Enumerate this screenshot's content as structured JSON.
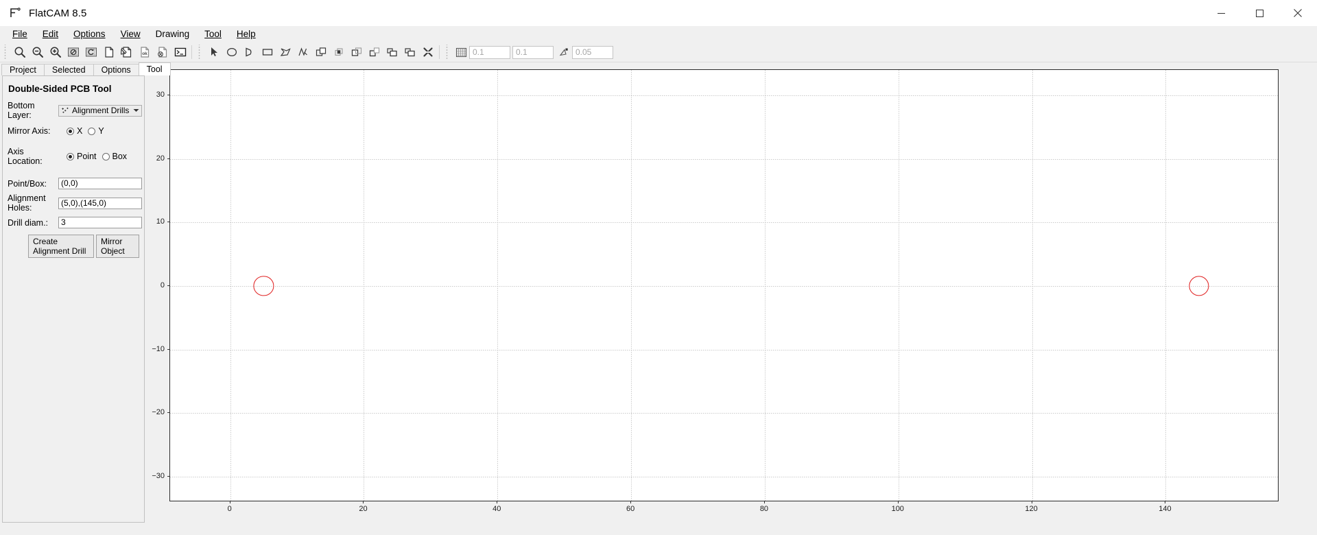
{
  "window": {
    "title": "FlatCAM 8.5",
    "app_icon": "flatcam-logo-icon",
    "minimize_label": "Minimize",
    "maximize_label": "Maximize",
    "close_label": "Close"
  },
  "menubar": {
    "items": [
      {
        "label": "File",
        "mnemonic": "F"
      },
      {
        "label": "Edit",
        "mnemonic": "E"
      },
      {
        "label": "Options",
        "mnemonic": "O"
      },
      {
        "label": "View",
        "mnemonic": "V"
      },
      {
        "label": "Drawing",
        "mnemonic": ""
      },
      {
        "label": "Tool",
        "mnemonic": "T"
      },
      {
        "label": "Help",
        "mnemonic": "H"
      }
    ]
  },
  "toolbar": {
    "group1": [
      {
        "name": "zoom-fit-icon",
        "tooltip": "Zoom Fit"
      },
      {
        "name": "zoom-out-icon",
        "tooltip": "Zoom Out"
      },
      {
        "name": "zoom-in-icon",
        "tooltip": "Zoom In"
      },
      {
        "name": "clear-plot-icon",
        "tooltip": "Clear Plot"
      },
      {
        "name": "replot-icon",
        "tooltip": "Replot"
      },
      {
        "name": "new-blank-geometry-icon",
        "tooltip": "New Blank Geometry"
      },
      {
        "name": "edit-geometry-icon",
        "tooltip": "Edit Geometry"
      },
      {
        "name": "update-geometry-ok-icon",
        "tooltip": "Update Geometry"
      },
      {
        "name": "delete-object-icon",
        "tooltip": "Delete Object"
      },
      {
        "name": "shell-terminal-icon",
        "tooltip": "Command Line"
      }
    ],
    "group2": [
      {
        "name": "select-arrow-icon",
        "tooltip": "Select"
      },
      {
        "name": "draw-circle-icon",
        "tooltip": "Add Circle"
      },
      {
        "name": "draw-arc-icon",
        "tooltip": "Add Arc"
      },
      {
        "name": "draw-rectangle-icon",
        "tooltip": "Add Rectangle"
      },
      {
        "name": "draw-polygon-icon",
        "tooltip": "Add Polygon"
      },
      {
        "name": "draw-path-icon",
        "tooltip": "Add Path"
      },
      {
        "name": "union-icon",
        "tooltip": "Union"
      },
      {
        "name": "intersection-icon",
        "tooltip": "Intersection"
      },
      {
        "name": "subtract-icon",
        "tooltip": "Subtraction"
      },
      {
        "name": "cut-path-icon",
        "tooltip": "Cut Path"
      },
      {
        "name": "copy-shape-icon",
        "tooltip": "Copy Shape"
      },
      {
        "name": "move-shape-icon",
        "tooltip": "Move Shape"
      },
      {
        "name": "delete-shape-icon",
        "tooltip": "Delete Shape"
      }
    ],
    "grid": {
      "grid_icon": "snap-to-grid-icon",
      "grid_x_value": "0.1",
      "grid_y_value": "0.1",
      "corner_snap_icon": "snap-to-corner-icon",
      "snap_max_value": "0.05"
    }
  },
  "tabs": {
    "items": [
      {
        "label": "Project",
        "active": false
      },
      {
        "label": "Selected",
        "active": false
      },
      {
        "label": "Options",
        "active": false
      },
      {
        "label": "Tool",
        "active": true
      }
    ]
  },
  "tool_panel": {
    "title": "Double-Sided PCB Tool",
    "bottom_layer": {
      "label": "Bottom Layer:",
      "value": "Alignment Drills",
      "icon": "alignment-drills-icon",
      "arrow_icon": "chevron-down-icon"
    },
    "mirror_axis": {
      "label": "Mirror Axis:",
      "options": [
        {
          "label": "X",
          "selected": true
        },
        {
          "label": "Y",
          "selected": false
        }
      ]
    },
    "axis_location": {
      "label": "Axis Location:",
      "options": [
        {
          "label": "Point",
          "selected": true
        },
        {
          "label": "Box",
          "selected": false
        }
      ]
    },
    "point_box": {
      "label": "Point/Box:",
      "value": "(0,0)",
      "placeholder": ""
    },
    "alignment_holes": {
      "label": "Alignment Holes:",
      "value": "(5,0),(145,0)",
      "placeholder": ""
    },
    "drill_diam": {
      "label": "Drill diam.:",
      "value": "3",
      "placeholder": ""
    },
    "buttons": [
      {
        "label": "Create Alignment Drill",
        "name": "create-alignment-drill-button"
      },
      {
        "label": "Mirror Object",
        "name": "mirror-object-button"
      }
    ]
  },
  "chart_data": {
    "type": "scatter",
    "title": "",
    "xlabel": "",
    "ylabel": "",
    "xlim": [
      -9,
      157
    ],
    "ylim": [
      -34,
      34
    ],
    "xticks": [
      0,
      20,
      40,
      60,
      80,
      100,
      120,
      140
    ],
    "yticks": [
      -30,
      -20,
      -10,
      0,
      10,
      20,
      30
    ],
    "grid": true,
    "grid_style": "dotted",
    "legend": "none",
    "series": [
      {
        "name": "Alignment Drills",
        "marker": "circle-outline",
        "color": "#e02020",
        "radius_units": 1.5,
        "points": [
          {
            "x": 5,
            "y": 0
          },
          {
            "x": 145,
            "y": 0
          }
        ]
      }
    ]
  }
}
